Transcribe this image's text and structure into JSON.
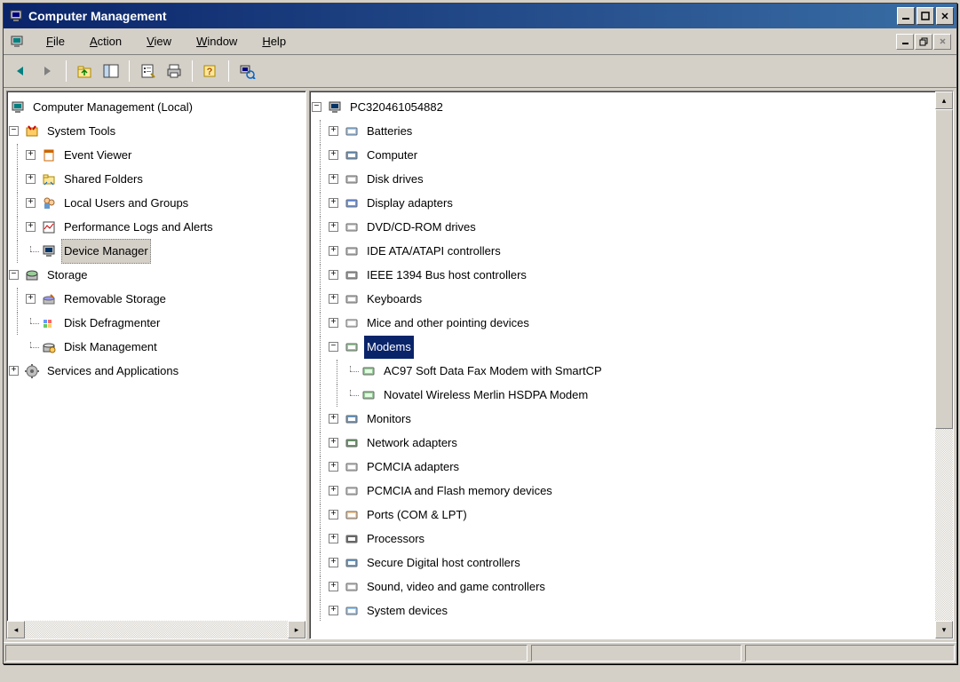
{
  "window": {
    "title": "Computer Management"
  },
  "menu": {
    "file": "File",
    "action": "Action",
    "view": "View",
    "window": "Window",
    "help": "Help"
  },
  "toolbar_icons": {
    "back": "back-arrow",
    "forward": "forward-arrow",
    "up": "up-folder",
    "properties": "properties",
    "refresh": "refresh",
    "print": "print",
    "help": "help",
    "device": "scan-hardware"
  },
  "left_tree": {
    "root": "Computer Management (Local)",
    "system_tools": {
      "label": "System Tools",
      "children": [
        "Event Viewer",
        "Shared Folders",
        "Local Users and Groups",
        "Performance Logs and Alerts",
        "Device Manager"
      ]
    },
    "storage": {
      "label": "Storage",
      "children": [
        "Removable Storage",
        "Disk Defragmenter",
        "Disk Management"
      ]
    },
    "services": {
      "label": "Services and Applications"
    }
  },
  "right_tree": {
    "root": "PC320461054882",
    "categories": [
      {
        "label": "Batteries",
        "expanded": false
      },
      {
        "label": "Computer",
        "expanded": false
      },
      {
        "label": "Disk drives",
        "expanded": false
      },
      {
        "label": "Display adapters",
        "expanded": false
      },
      {
        "label": "DVD/CD-ROM drives",
        "expanded": false
      },
      {
        "label": "IDE ATA/ATAPI controllers",
        "expanded": false
      },
      {
        "label": "IEEE 1394 Bus host controllers",
        "expanded": false
      },
      {
        "label": "Keyboards",
        "expanded": false
      },
      {
        "label": "Mice and other pointing devices",
        "expanded": false
      },
      {
        "label": "Modems",
        "expanded": true,
        "highlighted": true,
        "children": [
          "AC97 Soft Data Fax Modem with SmartCP",
          "Novatel Wireless Merlin HSDPA Modem"
        ]
      },
      {
        "label": "Monitors",
        "expanded": false
      },
      {
        "label": "Network adapters",
        "expanded": false
      },
      {
        "label": "PCMCIA adapters",
        "expanded": false
      },
      {
        "label": "PCMCIA and Flash memory devices",
        "expanded": false
      },
      {
        "label": "Ports (COM & LPT)",
        "expanded": false
      },
      {
        "label": "Processors",
        "expanded": false
      },
      {
        "label": "Secure Digital host controllers",
        "expanded": false
      },
      {
        "label": "Sound, video and game controllers",
        "expanded": false
      },
      {
        "label": "System devices",
        "expanded": false
      }
    ]
  }
}
